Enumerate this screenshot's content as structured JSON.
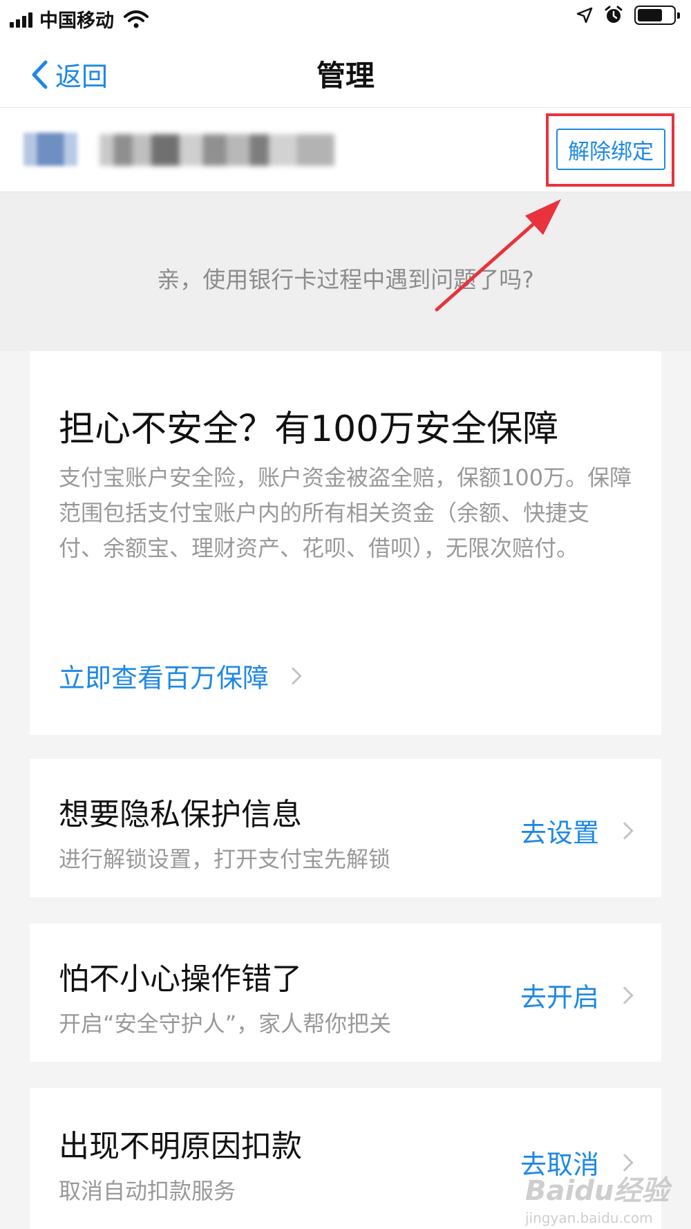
{
  "status_bar": {
    "carrier": "中国移动",
    "icons": [
      "signal-icon",
      "wifi-icon",
      "location-icon",
      "alarm-icon",
      "battery-icon"
    ]
  },
  "nav": {
    "back_label": "返回",
    "title": "管理"
  },
  "card_row": {
    "unbind_label": "解除绑定"
  },
  "help": {
    "text": "亲，使用银行卡过程中遇到问题了吗?"
  },
  "security_card": {
    "title": "担心不安全？有100万安全保障",
    "description": "支付宝账户安全险，账户资金被盗全赔，保额100万。保障范围包括支付宝账户内的所有相关资金（余额、快捷支付、余额宝、理财资产、花呗、借呗），无限次赔付。",
    "link_label": "立即查看百万保障"
  },
  "rows": [
    {
      "title": "想要隐私保护信息",
      "subtitle": "进行解锁设置，打开支付宝先解锁",
      "action": "去设置"
    },
    {
      "title": "怕不小心操作错了",
      "subtitle": "开启“安全守护人”，家人帮你把关",
      "action": "去开启"
    },
    {
      "title": "出现不明原因扣款",
      "subtitle": "取消自动扣款服务",
      "action": "去取消"
    }
  ],
  "watermark": {
    "main": "Baidu经验",
    "sub": "jingyan.baidu.com"
  },
  "colors": {
    "accent": "#1e88e5",
    "annotation": "#e8333d",
    "background": "#f4f4f4"
  }
}
